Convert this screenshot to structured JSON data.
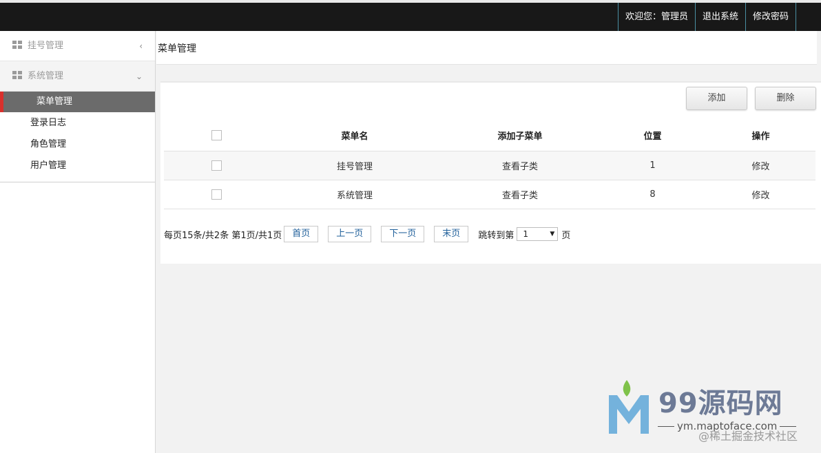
{
  "topbar": {
    "welcome": "欢迎您：管理员",
    "logout": "退出系统",
    "change_password": "修改密码"
  },
  "sidebar": {
    "groups": [
      {
        "label": "挂号管理",
        "icon": "grid-icon",
        "chevron": "‹"
      },
      {
        "label": "系统管理",
        "icon": "grid-icon",
        "chevron": "⌄"
      }
    ],
    "sub_items": [
      "菜单管理",
      "登录日志",
      "角色管理",
      "用户管理"
    ],
    "active_accent": "#d9302c"
  },
  "page": {
    "title": "菜单管理"
  },
  "toolbar": {
    "add": "添加",
    "delete": "删除"
  },
  "table": {
    "headers": [
      "菜单名",
      "添加子菜单",
      "位置",
      "操作"
    ],
    "rows": [
      {
        "name": "挂号管理",
        "sub": "查看子类",
        "position": "1",
        "op": "修改"
      },
      {
        "name": "系统管理",
        "sub": "查看子类",
        "position": "8",
        "op": "修改"
      }
    ]
  },
  "pager": {
    "info": "每页15条/共2条 第1页/共1页",
    "first": "首页",
    "prev": "上一页",
    "next": "下一页",
    "last": "末页",
    "jump_label": "跳转到第",
    "page_value": "1",
    "page_unit": "页"
  },
  "watermark": {
    "brand": "99源码网",
    "site": "ym.maptoface.com",
    "juejin": "@稀土掘金技术社区"
  }
}
